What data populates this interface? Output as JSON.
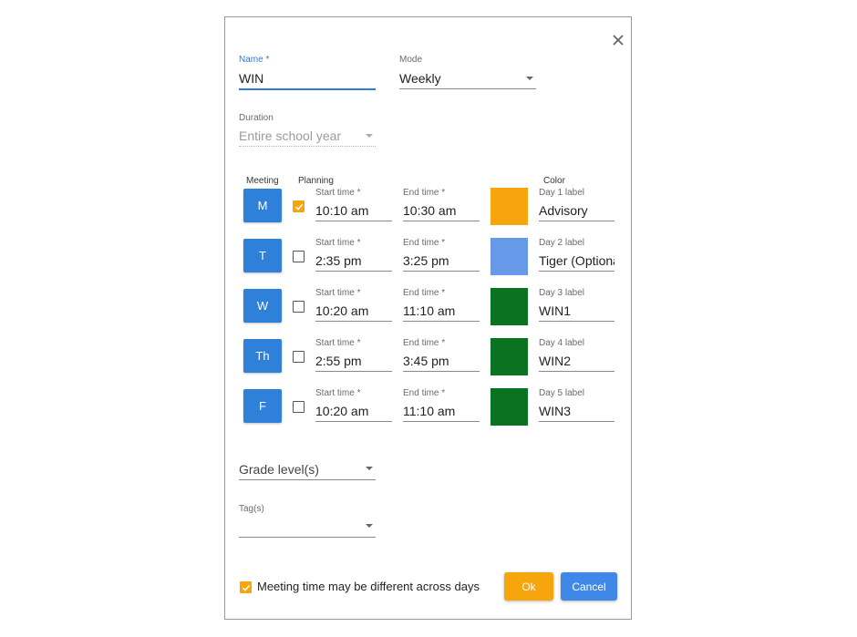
{
  "dialog": {
    "name_label": "Name *",
    "name_value": "WIN",
    "mode_label": "Mode",
    "mode_value": "Weekly",
    "duration_label": "Duration",
    "duration_value": "Entire school year",
    "col_meeting": "Meeting",
    "col_planning": "Planning",
    "col_color": "Color",
    "days": [
      {
        "abbr": "M",
        "planning": true,
        "start_label": "Start time *",
        "start": "10:10 am",
        "end_label": "End time *",
        "end": "10:30 am",
        "color": "#f7a50c",
        "day_label": "Day 1 label",
        "label_value": "Advisory"
      },
      {
        "abbr": "T",
        "planning": false,
        "start_label": "Start time *",
        "start": "2:35 pm",
        "end_label": "End time *",
        "end": "3:25 pm",
        "color": "#6699e8",
        "day_label": "Day 2 label",
        "label_value": "Tiger (Optional)"
      },
      {
        "abbr": "W",
        "planning": false,
        "start_label": "Start time *",
        "start": "10:20 am",
        "end_label": "End time *",
        "end": "11:10 am",
        "color": "#0a7322",
        "day_label": "Day 3 label",
        "label_value": "WIN1"
      },
      {
        "abbr": "Th",
        "planning": false,
        "start_label": "Start time *",
        "start": "2:55 pm",
        "end_label": "End time *",
        "end": "3:45 pm",
        "color": "#0a7322",
        "day_label": "Day 4 label",
        "label_value": "WIN2"
      },
      {
        "abbr": "F",
        "planning": false,
        "start_label": "Start time *",
        "start": "10:20 am",
        "end_label": "End time *",
        "end": "11:10 am",
        "color": "#0a7322",
        "day_label": "Day 5 label",
        "label_value": "WIN3"
      }
    ],
    "grade_placeholder": "Grade level(s)",
    "tags_label": "Tag(s)",
    "tags_value": "",
    "meeting_diff_label": "Meeting time may be different across days",
    "meeting_diff_checked": true,
    "ok_label": "Ok",
    "cancel_label": "Cancel"
  },
  "colors": {
    "accent": "#2f7bd8",
    "ok": "#f7a50c",
    "cancel": "#3f88e8"
  }
}
